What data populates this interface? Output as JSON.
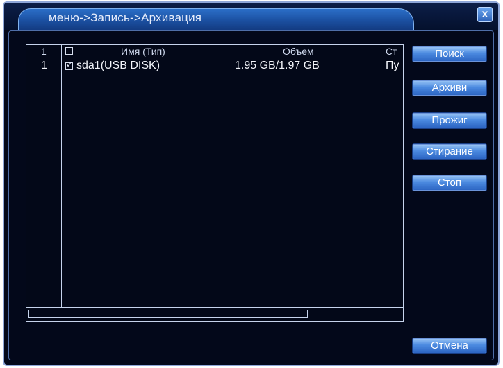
{
  "window": {
    "breadcrumb": "меню->Запись->Архивация",
    "close_symbol": "x"
  },
  "disk_list": {
    "headers": {
      "index": "1",
      "name": "Имя (Тип)",
      "capacity": "Объем",
      "status": "Ст"
    },
    "rows": [
      {
        "index": "1",
        "checked": true,
        "name": "sda1(USB DISK)",
        "capacity": "1.95 GB/1.97 GB",
        "status": "Пу"
      }
    ]
  },
  "buttons": {
    "search": "Поиск",
    "archive": "Архиви",
    "burn": "Прожиг",
    "erase": "Стирание",
    "stop": "Стоп",
    "cancel": "Отмена"
  },
  "icons": {
    "close": "close-icon",
    "checkbox": "checkbox-icon",
    "scroll_grip": "scroll-grip-icon"
  },
  "colors": {
    "background": "#03081a",
    "title_tab": "#1b4fa0",
    "button": "#4b8ae0",
    "border": "#c6d3ec"
  }
}
